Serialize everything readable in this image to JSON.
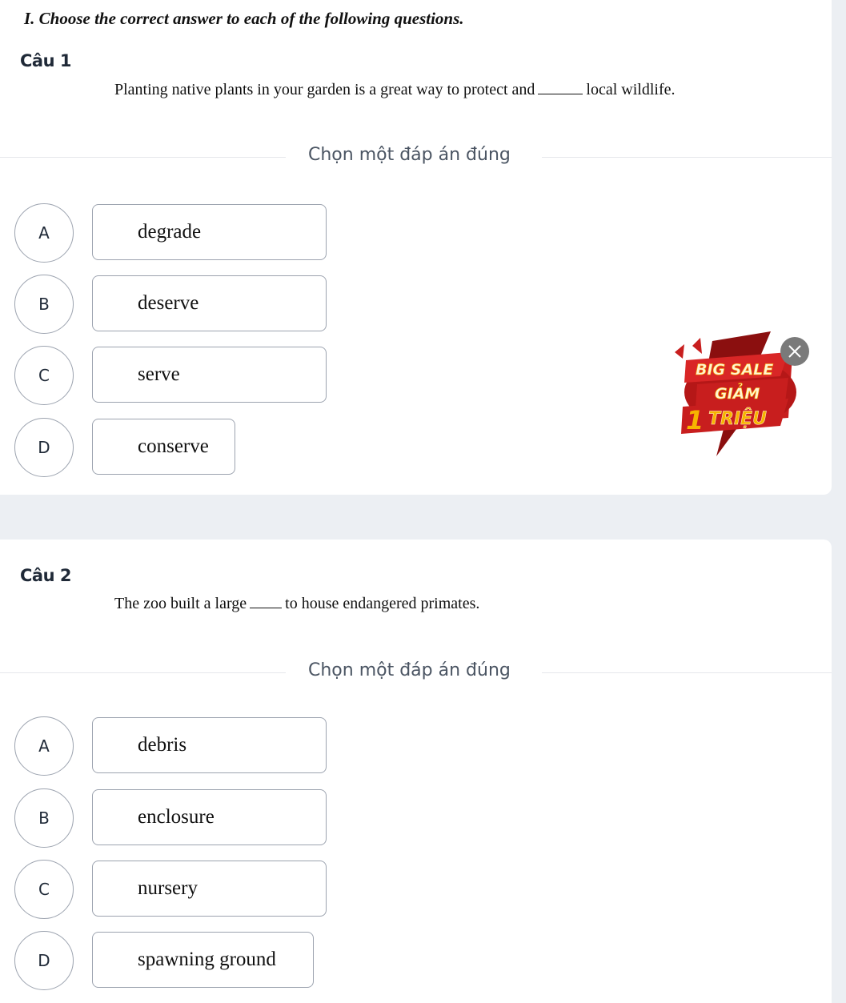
{
  "section_title": "I. Choose the correct answer to each of the following questions.",
  "divider_label": "Chọn một đáp án đúng",
  "questions": [
    {
      "label": "Câu 1",
      "text_before": "Planting native plants in your garden is a great way to protect and",
      "text_after": "local wildlife.",
      "options": [
        {
          "letter": "A",
          "text": "degrade"
        },
        {
          "letter": "B",
          "text": "deserve"
        },
        {
          "letter": "C",
          "text": "serve"
        },
        {
          "letter": "D",
          "text": "conserve"
        }
      ]
    },
    {
      "label": "Câu 2",
      "text_before": "The zoo built a large",
      "text_after": "to house endangered primates.",
      "options": [
        {
          "letter": "A",
          "text": "debris"
        },
        {
          "letter": "B",
          "text": "enclosure"
        },
        {
          "letter": "C",
          "text": "nursery"
        },
        {
          "letter": "D",
          "text": "spawning ground"
        }
      ]
    }
  ],
  "ad": {
    "line1": "BIG SALE",
    "line2": "GIẢM",
    "line3_num": "1",
    "line3_text": "TRIỆU",
    "close_icon": "close-icon",
    "colors": {
      "red": "#c81e1e",
      "dark_red": "#8b0f0f",
      "gold": "#f7b500",
      "cream": "#fff3d6"
    }
  }
}
